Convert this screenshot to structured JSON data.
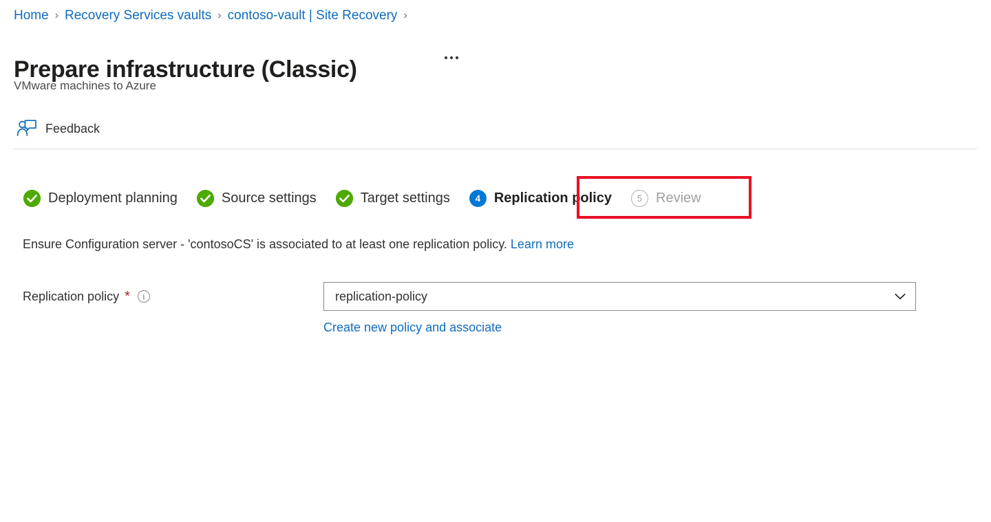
{
  "breadcrumb": {
    "separator": "›",
    "items": [
      {
        "label": "Home"
      },
      {
        "label": "Recovery Services vaults"
      },
      {
        "label": "contoso-vault | Site Recovery"
      }
    ]
  },
  "header": {
    "title": "Prepare infrastructure (Classic)",
    "subtitle": "VMware machines to Azure",
    "more_menu": "···"
  },
  "commandbar": {
    "feedback_label": "Feedback",
    "feedback_icon": "person-feedback-icon"
  },
  "wizard": {
    "tabs": [
      {
        "label": "Deployment planning",
        "badge": "✓",
        "state": "done"
      },
      {
        "label": "Source settings",
        "badge": "✓",
        "state": "done"
      },
      {
        "label": "Target settings",
        "badge": "✓",
        "state": "done"
      },
      {
        "label": "Replication policy",
        "badge": "4",
        "state": "current"
      },
      {
        "label": "Review",
        "badge": "5",
        "state": "pending"
      }
    ],
    "highlight_color": "#e81123",
    "highlighted_tab": "Replication policy"
  },
  "content": {
    "info_text": "Ensure Configuration server - 'contosoCS' is associated to at least one replication policy.",
    "info_link": "Learn more",
    "field": {
      "label": "Replication policy",
      "required_mark": "*",
      "info_icon": "info-circle-icon",
      "selected_value": "replication-policy",
      "dropdown_icon": "chevron-down-icon",
      "create_link": "Create new policy and associate"
    }
  },
  "colors": {
    "accent": "#0078d4",
    "link": "#0f6cbd",
    "success": "#4eaa00",
    "required": "#a4262c",
    "highlight": "#e81123"
  }
}
